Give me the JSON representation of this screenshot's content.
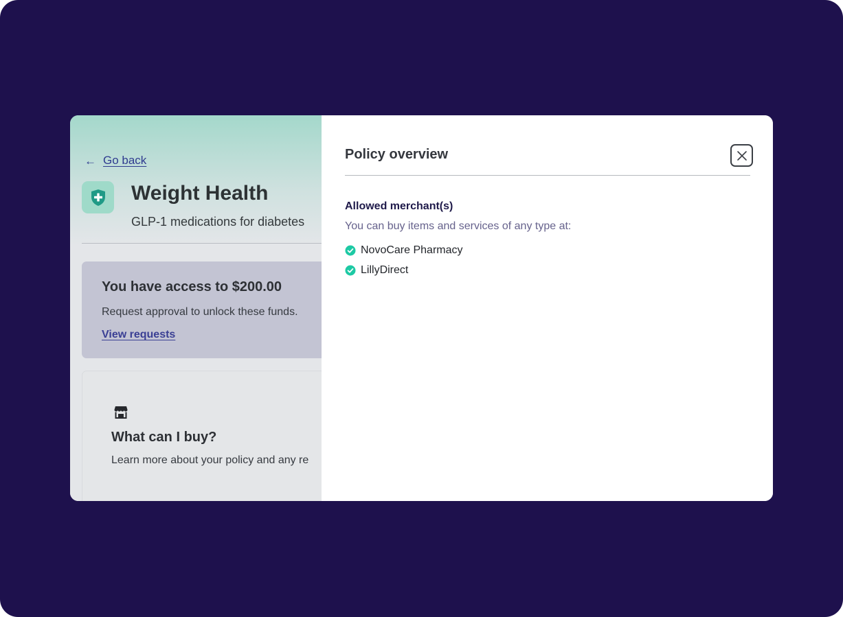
{
  "colors": {
    "background": "#1e114d",
    "accent_teal": "#1dc9a4",
    "link": "#2f3b8f"
  },
  "page": {
    "back_label": "Go back",
    "back_icon": "arrow-left-icon",
    "title_icon": "shield-plus-icon",
    "title": "Weight Health",
    "subtitle": "GLP-1 medications for diabetes",
    "access_card": {
      "title": "You have access to $200.00",
      "description": "Request approval to unlock these funds.",
      "link": "View requests"
    },
    "buy_card": {
      "icon": "storefront-icon",
      "title": "What can I buy?",
      "description": "Learn more about your policy and any re"
    }
  },
  "panel": {
    "title": "Policy overview",
    "close_icon": "close-icon",
    "section_title": "Allowed merchant(s)",
    "section_description": "You can buy items and services of any type at:",
    "merchants": [
      {
        "name": "NovoCare Pharmacy",
        "icon": "check-circle-icon"
      },
      {
        "name": "LillyDirect",
        "icon": "check-circle-icon"
      }
    ]
  }
}
